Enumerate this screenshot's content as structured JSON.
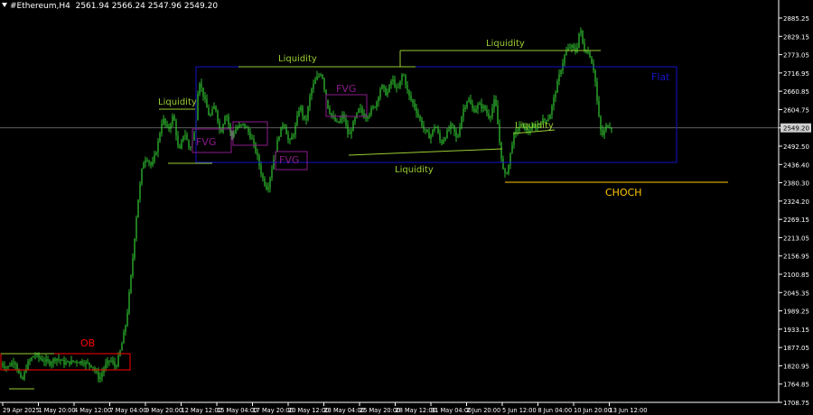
{
  "header": {
    "symbol": "#Ethereum,H4",
    "ohlc": "2561.94 2566.24 2547.96 2549.20"
  },
  "colors": {
    "background": "#000000",
    "axis": "#ffffff",
    "candle": "#32cd32",
    "liquidity": "#9acd32",
    "flat_box": "#1515c8",
    "fvg": "#8b1c8b",
    "ob": "#ff0000",
    "choch": "#ffc800",
    "price_line": "#6b6b6b"
  },
  "chart_data": {
    "type": "candlestick",
    "ylim": [
      1708.97,
      2900
    ],
    "y_ticks": [
      "2885.25",
      "2829.15",
      "2773.05",
      "2716.95",
      "2660.85",
      "2604.75",
      "2549.20",
      "2492.50",
      "2436.40",
      "2380.30",
      "2324.20",
      "2269.15",
      "2213.05",
      "2156.95",
      "2100.85",
      "2045.35",
      "1989.25",
      "1933.15",
      "1877.05",
      "1820.95",
      "1764.85",
      "1708.75"
    ],
    "x_ticks": [
      "29 Apr 2025",
      "1 May 20:00",
      "4 May 12:00",
      "7 May 04:00",
      "9 May 20:00",
      "12 May 12:00",
      "15 May 04:00",
      "17 May 20:00",
      "20 May 12:00",
      "23 May 04:00",
      "25 May 20:00",
      "28 May 12:00",
      "31 May 04:00",
      "2 Jun 20:00",
      "5 Jun 12:00",
      "8 Jun 04:00",
      "10 Jun 20:00",
      "13 Jun 12:00"
    ],
    "current_price": "2549.20",
    "price_path": [
      [
        0,
        1830
      ],
      [
        8,
        1815
      ],
      [
        16,
        1838
      ],
      [
        24,
        1770
      ],
      [
        30,
        1825
      ],
      [
        38,
        1855
      ],
      [
        46,
        1840
      ],
      [
        55,
        1830
      ],
      [
        62,
        1845
      ],
      [
        72,
        1828
      ],
      [
        82,
        1835
      ],
      [
        92,
        1832
      ],
      [
        102,
        1822
      ],
      [
        110,
        1780
      ],
      [
        116,
        1820
      ],
      [
        122,
        1840
      ],
      [
        128,
        1815
      ],
      [
        134,
        1875
      ],
      [
        140,
        1960
      ],
      [
        146,
        2120
      ],
      [
        152,
        2310
      ],
      [
        158,
        2440
      ],
      [
        162,
        2460
      ],
      [
        168,
        2430
      ],
      [
        174,
        2490
      ],
      [
        180,
        2580
      ],
      [
        186,
        2540
      ],
      [
        192,
        2590
      ],
      [
        198,
        2470
      ],
      [
        204,
        2540
      ],
      [
        210,
        2480
      ],
      [
        216,
        2540
      ],
      [
        220,
        2700
      ],
      [
        226,
        2640
      ],
      [
        232,
        2580
      ],
      [
        238,
        2620
      ],
      [
        244,
        2530
      ],
      [
        250,
        2600
      ],
      [
        256,
        2520
      ],
      [
        262,
        2550
      ],
      [
        270,
        2560
      ],
      [
        278,
        2520
      ],
      [
        284,
        2470
      ],
      [
        290,
        2400
      ],
      [
        296,
        2360
      ],
      [
        302,
        2440
      ],
      [
        308,
        2520
      ],
      [
        314,
        2570
      ],
      [
        320,
        2500
      ],
      [
        326,
        2540
      ],
      [
        332,
        2620
      ],
      [
        338,
        2560
      ],
      [
        344,
        2660
      ],
      [
        350,
        2700
      ],
      [
        356,
        2720
      ],
      [
        362,
        2620
      ],
      [
        368,
        2580
      ],
      [
        374,
        2560
      ],
      [
        380,
        2590
      ],
      [
        386,
        2520
      ],
      [
        392,
        2570
      ],
      [
        398,
        2610
      ],
      [
        404,
        2580
      ],
      [
        410,
        2600
      ],
      [
        416,
        2620
      ],
      [
        422,
        2680
      ],
      [
        428,
        2650
      ],
      [
        434,
        2700
      ],
      [
        440,
        2660
      ],
      [
        446,
        2720
      ],
      [
        452,
        2650
      ],
      [
        458,
        2620
      ],
      [
        464,
        2580
      ],
      [
        470,
        2540
      ],
      [
        476,
        2520
      ],
      [
        482,
        2560
      ],
      [
        488,
        2500
      ],
      [
        494,
        2530
      ],
      [
        500,
        2560
      ],
      [
        506,
        2510
      ],
      [
        512,
        2600
      ],
      [
        518,
        2640
      ],
      [
        524,
        2600
      ],
      [
        530,
        2620
      ],
      [
        536,
        2610
      ],
      [
        542,
        2580
      ],
      [
        548,
        2640
      ],
      [
        554,
        2480
      ],
      [
        558,
        2400
      ],
      [
        562,
        2420
      ],
      [
        568,
        2520
      ],
      [
        576,
        2560
      ],
      [
        584,
        2540
      ],
      [
        592,
        2550
      ],
      [
        600,
        2570
      ],
      [
        608,
        2580
      ],
      [
        614,
        2650
      ],
      [
        620,
        2720
      ],
      [
        626,
        2780
      ],
      [
        632,
        2800
      ],
      [
        638,
        2780
      ],
      [
        642,
        2860
      ],
      [
        646,
        2790
      ],
      [
        652,
        2780
      ],
      [
        658,
        2720
      ],
      [
        662,
        2600
      ],
      [
        666,
        2520
      ],
      [
        672,
        2560
      ],
      [
        678,
        2549.2
      ]
    ]
  },
  "annotations": {
    "ob": "OB",
    "flat": "Flat",
    "choch": "CHOCH",
    "fvg": "FVG",
    "liquidity": "Liquidity"
  }
}
